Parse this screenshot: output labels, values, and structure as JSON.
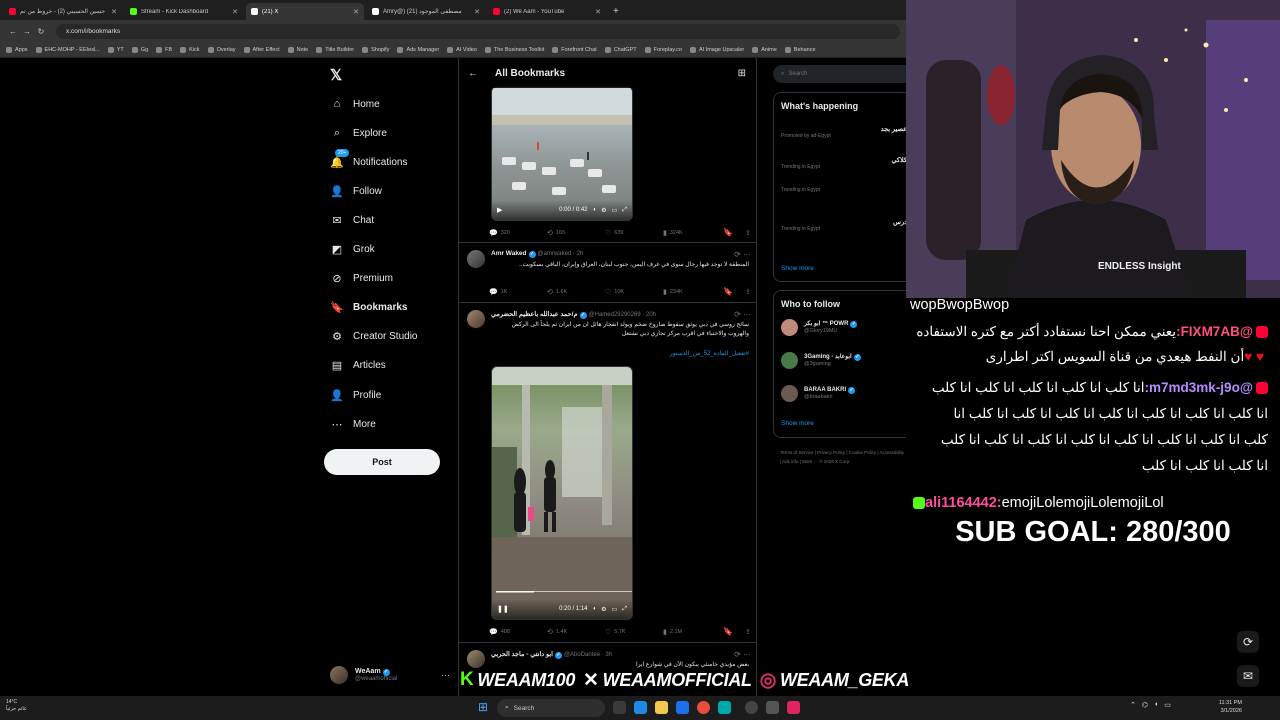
{
  "browser": {
    "tabs": [
      {
        "title": "حسين الحسيني (2) - خروط من تم",
        "icon_color": "#ff0033",
        "active": false
      },
      {
        "title": "Stream - Kick Dashboard",
        "icon_color": "#53fc18",
        "active": false
      },
      {
        "title": "(21) X",
        "icon_color": "#ffffff",
        "active": true
      },
      {
        "title": "Amry@) مصطفى الموجود (21)",
        "icon_color": "#ffffff",
        "active": false
      },
      {
        "title": "(2) We Aam - YouTube",
        "icon_color": "#ff0033",
        "active": false
      }
    ],
    "url": "x.com/i/bookmarks",
    "bookmarks": [
      "Apps",
      "EHC-MOHP - EEIesl...",
      "YT",
      "Gg",
      "FB",
      "Kick",
      "Overlay",
      "After Effect",
      "Note",
      "Title Builder",
      "Shopify",
      "Ads Manager",
      "AI Video",
      "The Business Toolkit",
      "Forefront Chat",
      "ChatGPT",
      "Foreplay.co",
      "AI Image Upscaler",
      "Anime",
      "Behance"
    ]
  },
  "leftnav": {
    "items": [
      {
        "label": "Home",
        "icon": "home-icon",
        "glyph": "⌂",
        "bold": false
      },
      {
        "label": "Explore",
        "icon": "search-icon",
        "glyph": "⌕",
        "bold": false
      },
      {
        "label": "Notifications",
        "icon": "bell-icon",
        "glyph": "🔔",
        "bold": false,
        "badge": "20+"
      },
      {
        "label": "Follow",
        "icon": "person-add-icon",
        "glyph": "👤",
        "bold": false
      },
      {
        "label": "Chat",
        "icon": "mail-icon",
        "glyph": "✉",
        "bold": false
      },
      {
        "label": "Grok",
        "icon": "grok-icon",
        "glyph": "◩",
        "bold": false
      },
      {
        "label": "Premium",
        "icon": "x-premium-icon",
        "glyph": "⊘",
        "bold": false
      },
      {
        "label": "Bookmarks",
        "icon": "bookmark-icon",
        "glyph": "🔖",
        "bold": true
      },
      {
        "label": "Creator Studio",
        "icon": "creator-studio-icon",
        "glyph": "⚙",
        "bold": false
      },
      {
        "label": "Articles",
        "icon": "articles-icon",
        "glyph": "▤",
        "bold": false
      },
      {
        "label": "Profile",
        "icon": "profile-icon",
        "glyph": "👤",
        "bold": false
      },
      {
        "label": "More",
        "icon": "more-circle-icon",
        "glyph": "⋯",
        "bold": false
      }
    ],
    "post_label": "Post",
    "profile_name": "WeAam",
    "profile_handle": "@weaamofficial"
  },
  "feed": {
    "title": "All Bookmarks",
    "tweet1": {
      "time": "0:00 / 0:42",
      "replies": "320",
      "reposts": "165",
      "likes": "639",
      "views": "324K"
    },
    "tweet2": {
      "name": "Amr Waked",
      "handle": "@amrwaked · 2h",
      "text": "المنطقة لا توجد فيها رجال سوى في غرف اليمن، جنوب لبنان، العراق وإيران، الباقي بسكويت..",
      "replies": "1K",
      "reposts": "1.6K",
      "likes": "10K",
      "views": "234K"
    },
    "tweet3": {
      "name": "م/حمد عبدالله باعظيم الحضرمي",
      "handle": "@Hamed29290269 · 20h",
      "text": "سائح روسي في دبي يوثق سقوط صاروخ ضخم ويولد انفجار هائل ان من ايران ثم يلجأ الى الركض والهروب والاختباء في اقرب مركز تجاري دبي تشتعل",
      "hashtag": "#تفعيل_المادة_52_من_الدستور",
      "time": "0:20 / 1:14",
      "replies": "408",
      "reposts": "1.4K",
      "likes": "5.7K",
      "views": "2.1M"
    },
    "tweet4": {
      "name": "ابو دانتي - ماجد الحربي",
      "handle": "@AboDantee · 3h",
      "text": "بعض مؤيدي خامنئي يبكون الآن في شوارع ايرا"
    }
  },
  "rightcol": {
    "search_placeholder": "Search",
    "happening_title": "What's happening",
    "trends": [
      {
        "meta": "Promoted by ad-Egypt",
        "title": "عصير بجد"
      },
      {
        "meta": "Trending in Egypt",
        "title": "كلاكي"
      },
      {
        "meta": "Trending in Egypt",
        "title": ""
      },
      {
        "meta": "Trending in Egypt",
        "title": "درس"
      }
    ],
    "show_more": "Show more",
    "who_title": "Who to follow",
    "who": [
      {
        "name": "ابو بكر ™ POWR",
        "handle": "@Glory19MU"
      },
      {
        "name": "3Gaming - ابوعابد",
        "handle": "@3gaming"
      },
      {
        "name": "BARAA BAKRI",
        "handle": "@braabakri"
      }
    ],
    "footer": "Terms of Service | Privacy Policy | Cookie Policy | Accessibility | Ads info | More ··· © 2026 X Corp."
  },
  "stream": {
    "webcam_text": "ENDLESS Insight",
    "chat": [
      {
        "text": "wopBwopBwop",
        "name": "",
        "platform": ""
      },
      {
        "text": "يعني ممكن احنا نستفادد أكتر مع كتره الاستفاده",
        "name": "@FIXM7AB:",
        "platform": "youtube",
        "name_color": "#ff4f7b"
      },
      {
        "text": "أن النفط هيعدي من قناة السويس اكتر اطرارى",
        "name": "",
        "platform": "",
        "hearts": "♥ ♥"
      },
      {
        "text": "انا كلب انا كلب انا كلب انا كلب انا كلب",
        "name": "@m7md3mk-j9o:",
        "platform": "youtube",
        "name_color": "#b48cff"
      },
      {
        "text": "انا كلب انا كلب انا كلب انا كلب انا كلب انا كلب انا كلب انا",
        "name": "",
        "platform": ""
      },
      {
        "text": "كلب انا كلب انا كلب انا كلب انا كلب انا كلب انا كلب انا كلب",
        "name": "",
        "platform": ""
      },
      {
        "text": "انا كلب انا كلب انا كلب",
        "name": "",
        "platform": ""
      },
      {
        "text": "emojiLolemojiLolemojiLol",
        "name": "ali1164442:",
        "platform": "kick",
        "name_color": "#ff4f9b"
      }
    ],
    "sub_goal": "SUB GOAL: 280/300"
  },
  "social": {
    "kick": "WEAAM100",
    "x": "WEAAMOFFICIAL",
    "instagram": "WEAAM_GEKA"
  },
  "taskbar": {
    "weather_temp": "14°C",
    "weather_desc": "غائم جزئياً",
    "search_placeholder": "Search",
    "time": "11:31 PM",
    "date": "3/1/2026"
  }
}
